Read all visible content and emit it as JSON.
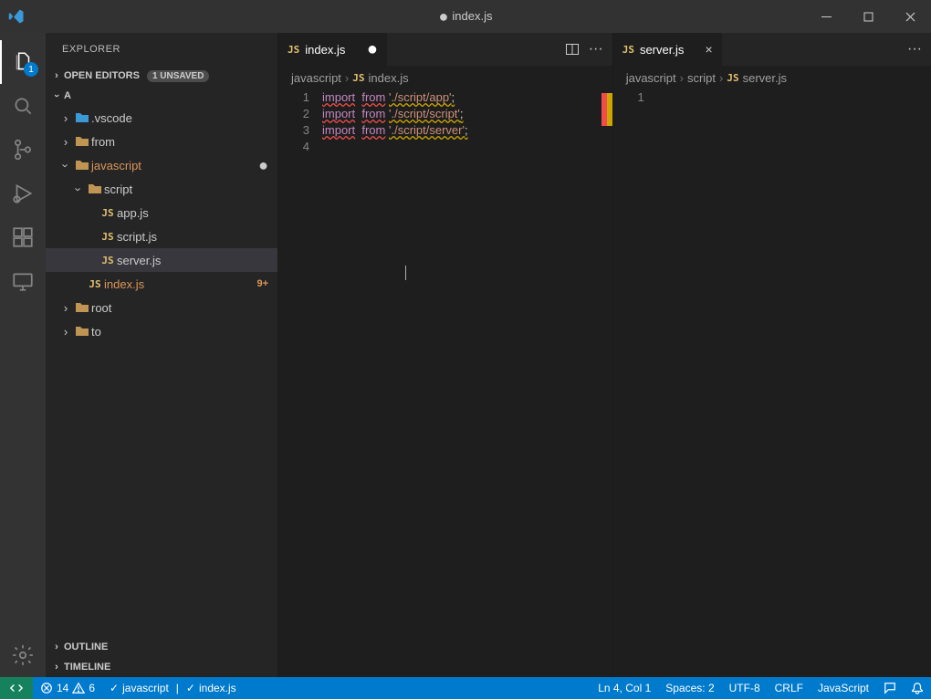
{
  "window": {
    "title": "index.js",
    "dirty": true
  },
  "activitybar": {
    "badge": "1"
  },
  "sidebar": {
    "title": "EXPLORER",
    "openEditors": {
      "label": "OPEN EDITORS",
      "unsaved": "1 UNSAVED"
    },
    "root": "A",
    "outline": "OUTLINE",
    "timeline": "TIMELINE",
    "tree": [
      {
        "name": ".vscode",
        "kind": "folder-vs",
        "indent": 1
      },
      {
        "name": "from",
        "kind": "folder",
        "indent": 1
      },
      {
        "name": "javascript",
        "kind": "folder",
        "indent": 1,
        "open": true,
        "modified": true,
        "dirty": true
      },
      {
        "name": "script",
        "kind": "folder-sym",
        "indent": 2,
        "open": true
      },
      {
        "name": "app.js",
        "kind": "js",
        "indent": 3
      },
      {
        "name": "script.js",
        "kind": "js",
        "indent": 3
      },
      {
        "name": "server.js",
        "kind": "js",
        "indent": 3,
        "active": true
      },
      {
        "name": "index.js",
        "kind": "js",
        "indent": 2,
        "modified": true,
        "git": "9+"
      },
      {
        "name": "root",
        "kind": "folder",
        "indent": 1
      },
      {
        "name": "to",
        "kind": "folder",
        "indent": 1
      }
    ]
  },
  "editors": {
    "left": {
      "tab": {
        "label": "index.js",
        "dirty": true
      },
      "breadcrumbs": [
        "javascript",
        "index.js"
      ],
      "bc_icon": "JS",
      "code": [
        {
          "n": "1",
          "import": "import",
          "from": "from",
          "path": "'./script/app'",
          "semi": ";"
        },
        {
          "n": "2",
          "import": "import",
          "from": "from",
          "path": "'./script/script'",
          "semi": ";"
        },
        {
          "n": "3",
          "import": "import",
          "from": "from",
          "path": "'./script/server'",
          "semi": ";"
        },
        {
          "n": "4"
        }
      ]
    },
    "right": {
      "tab": {
        "label": "server.js",
        "dirty": false
      },
      "breadcrumbs": [
        "javascript",
        "script",
        "server.js"
      ],
      "bc_icon": "JS",
      "code": [
        {
          "n": "1"
        }
      ]
    }
  },
  "statusbar": {
    "errors": "14",
    "warnings": "6",
    "check1": "javascript",
    "check2": "index.js",
    "lncol": "Ln 4, Col 1",
    "spaces": "Spaces: 2",
    "encoding": "UTF-8",
    "eol": "CRLF",
    "lang": "JavaScript"
  }
}
